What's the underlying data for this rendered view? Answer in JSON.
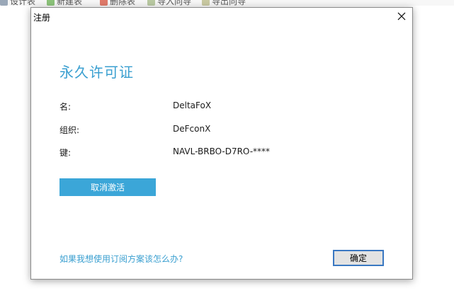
{
  "background_toolbar": {
    "items": [
      "设计表",
      "新建表",
      "删除表",
      "导入向导",
      "导出向导"
    ]
  },
  "dialog": {
    "title": "注册",
    "heading": "永久许可证",
    "fields": [
      {
        "label": "名:",
        "value": "DeltaFoX"
      },
      {
        "label": "组织:",
        "value": "DeFconX"
      },
      {
        "label": "键:",
        "value": "NAVL-BRBO-D7RO-****"
      }
    ],
    "deactivate_label": "取消激活",
    "help_link": "如果我想使用订阅方案该怎么办?",
    "ok_label": "确定"
  },
  "colors": {
    "accent": "#3a9fd0",
    "button_fill": "#3ba6d8",
    "ok_border": "#3a78c2"
  }
}
